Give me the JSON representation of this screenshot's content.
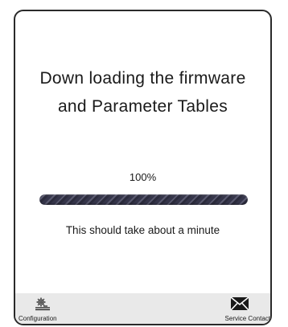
{
  "title": {
    "line1": "Down loading the firmware",
    "line2": "and Parameter Tables"
  },
  "progress": {
    "percent_text": "100%",
    "value": 1.0
  },
  "note": "This should take about a minute",
  "footer": {
    "configuration": {
      "label": "Configuration",
      "icon": "configuration-icon"
    },
    "service_contact": {
      "label": "Service Contact",
      "icon": "envelope-icon"
    }
  },
  "colors": {
    "progress_fill": "#35354a",
    "footer_bg": "#e9e9e9",
    "frame_border": "#2a2a2a"
  }
}
